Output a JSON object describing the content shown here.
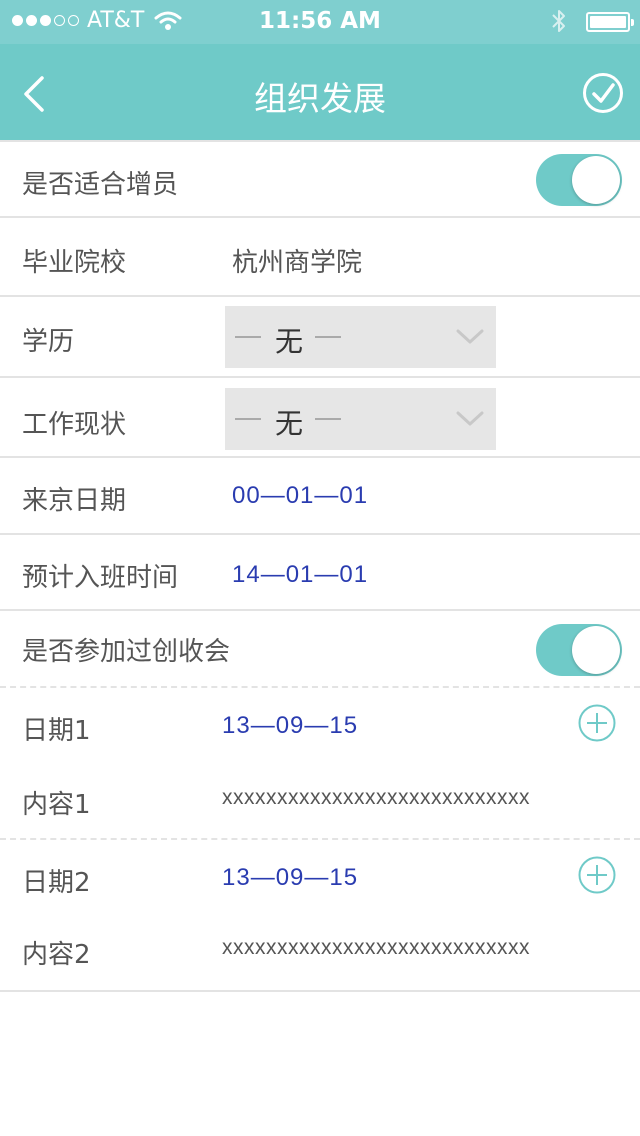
{
  "status_bar": {
    "carrier": "AT&T",
    "time": "11:56 AM",
    "signal_dots_filled": 3,
    "signal_dots_total": 5
  },
  "nav": {
    "title": "组织发展",
    "back_icon": "chevron-left-icon",
    "confirm_icon": "check-circle-icon"
  },
  "form": {
    "suitable_for_recruit": {
      "label": "是否适合增员",
      "toggle_on": true
    },
    "school": {
      "label": "毕业院校",
      "value": "杭州商学院"
    },
    "education": {
      "label": "学历",
      "selected": "无",
      "dash": "—"
    },
    "work_status": {
      "label": "工作现状",
      "selected": "无",
      "dash": "—"
    },
    "arrival_date": {
      "label": "来京日期",
      "value": "00—01—01"
    },
    "class_date": {
      "label": "预计入班时间",
      "value": "14—01—01"
    },
    "attended_meeting": {
      "label": "是否参加过创收会",
      "toggle_on": true
    },
    "entries": [
      {
        "date_label": "日期1",
        "date_value": "13—09—15",
        "content_label": "内容1",
        "content_value": "xxxxxxxxxxxxxxxxxxxxxxxxxxxx"
      },
      {
        "date_label": "日期2",
        "date_value": "13—09—15",
        "content_label": "内容2",
        "content_value": "xxxxxxxxxxxxxxxxxxxxxxxxxxxx"
      }
    ]
  },
  "colors": {
    "accent": "#6fcac8",
    "status_bar": "#7fcfcf",
    "date_text": "#2a3cb0",
    "divider": "#e3e3e3"
  }
}
